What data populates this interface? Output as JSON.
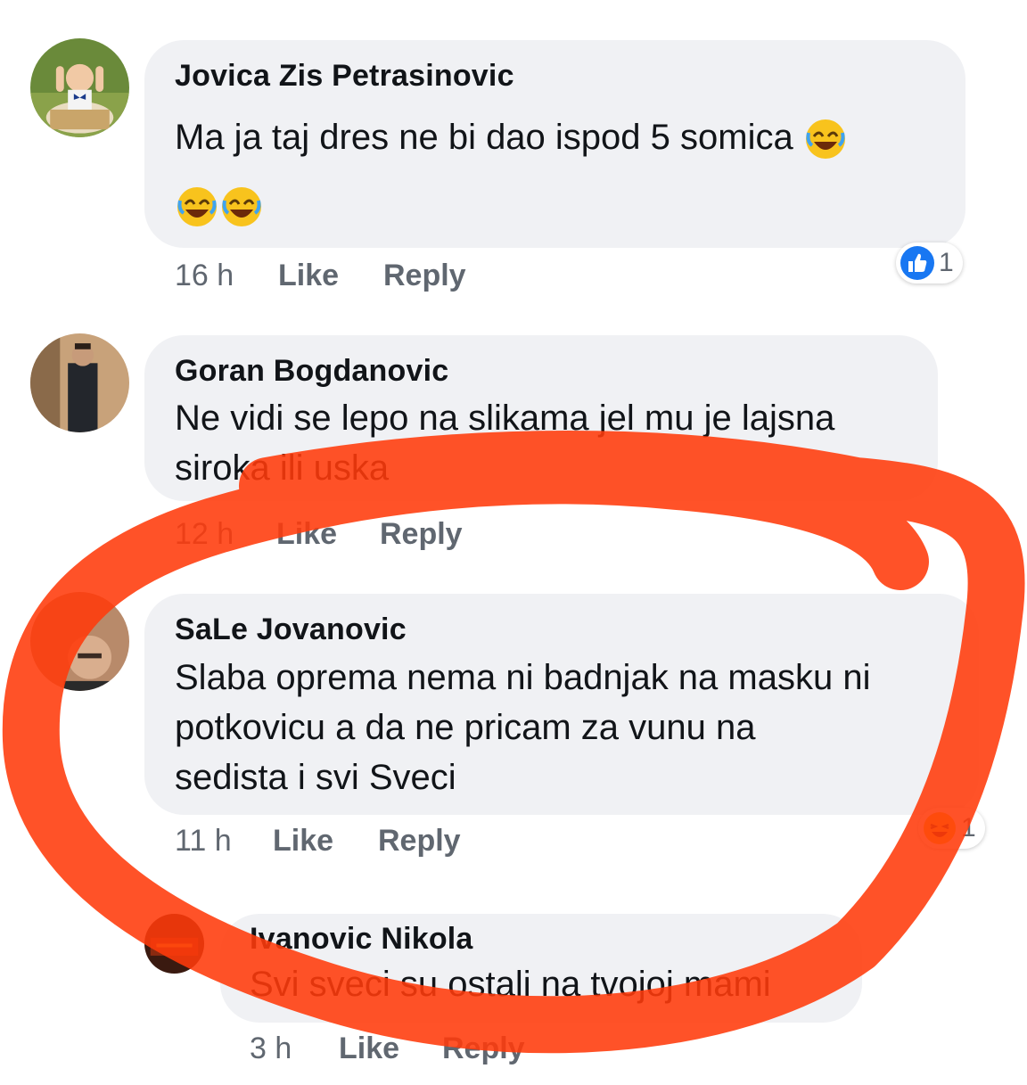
{
  "comments": [
    {
      "author": "Jovica Zis Petrasinovic",
      "text_line1": "Ma ja taj dres ne bi dao ispod 5 somica",
      "time": "16 h",
      "like_label": "Like",
      "reply_label": "Reply",
      "reaction": {
        "icon": "thumbs-up-icon",
        "count": "1"
      }
    },
    {
      "author": "Goran Bogdanovic",
      "text_line1": "Ne vidi se lepo na slikama jel mu je lajsna",
      "text_line2": "siroka ili uska",
      "time": "12 h",
      "like_label": "Like",
      "reply_label": "Reply"
    },
    {
      "author": "SaLe Jovanovic",
      "text_line1": "Slaba oprema nema ni badnjak na masku ni",
      "text_line2": "potkovicu a da ne pricam za vunu na",
      "text_line3": "sedista i svi Sveci",
      "time": "11 h",
      "like_label": "Like",
      "reply_label": "Reply",
      "reaction": {
        "icon": "haha-icon",
        "count": "1"
      }
    }
  ],
  "reply": {
    "author": "Ivanovic Nikola",
    "text_line1": "Svi sveci su ostali na tvojoj mami",
    "time": "3 h",
    "like_label": "Like",
    "reply_label": "Reply"
  },
  "colors": {
    "bubble": "#f0f1f4",
    "meta_text": "#606770",
    "like_blue": "#1877f2",
    "annotation_marker": "#ff3a0a"
  }
}
